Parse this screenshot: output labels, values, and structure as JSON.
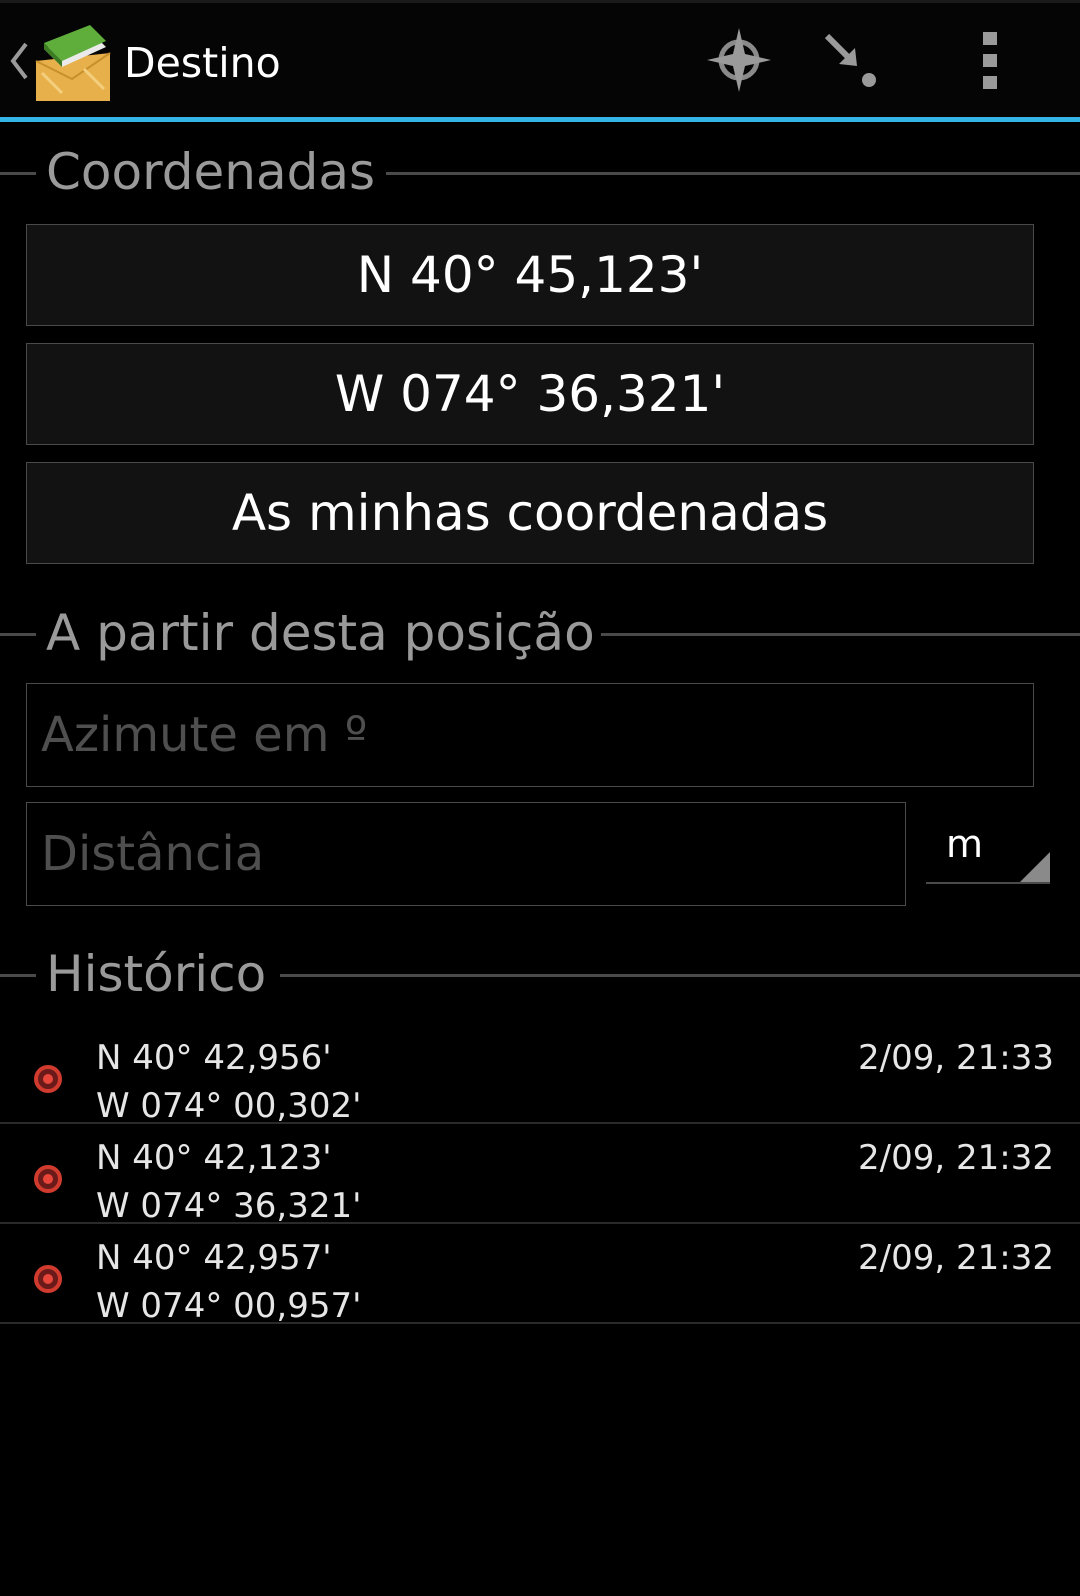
{
  "action_bar": {
    "title": "Destino",
    "icons": [
      "chevron-left-icon",
      "app-map-icon",
      "target-crosshair-icon",
      "arrow-to-point-icon",
      "overflow-menu-icon"
    ],
    "accent_color": "#33b5e5"
  },
  "sections": {
    "coordinates": "Coordenadas",
    "projection": "A partir desta posição",
    "history": "Histórico"
  },
  "coordinates": {
    "latitude": "N 40° 45,123'",
    "longitude": "W 074° 36,321'",
    "my_coords_label": "As minhas coordenadas"
  },
  "projection": {
    "bearing_placeholder": "Azimute em º",
    "bearing_value": "",
    "distance_placeholder": "Distância",
    "distance_value": "",
    "unit_selected": "m"
  },
  "history": [
    {
      "lat": "N 40° 42,956'",
      "lon": "W 074° 00,302'",
      "time": "2/09, 21:33"
    },
    {
      "lat": "N 40° 42,123'",
      "lon": "W 074° 36,321'",
      "time": "2/09, 21:32"
    },
    {
      "lat": "N 40° 42,957'",
      "lon": "W 074° 00,957'",
      "time": "2/09, 21:32"
    }
  ]
}
